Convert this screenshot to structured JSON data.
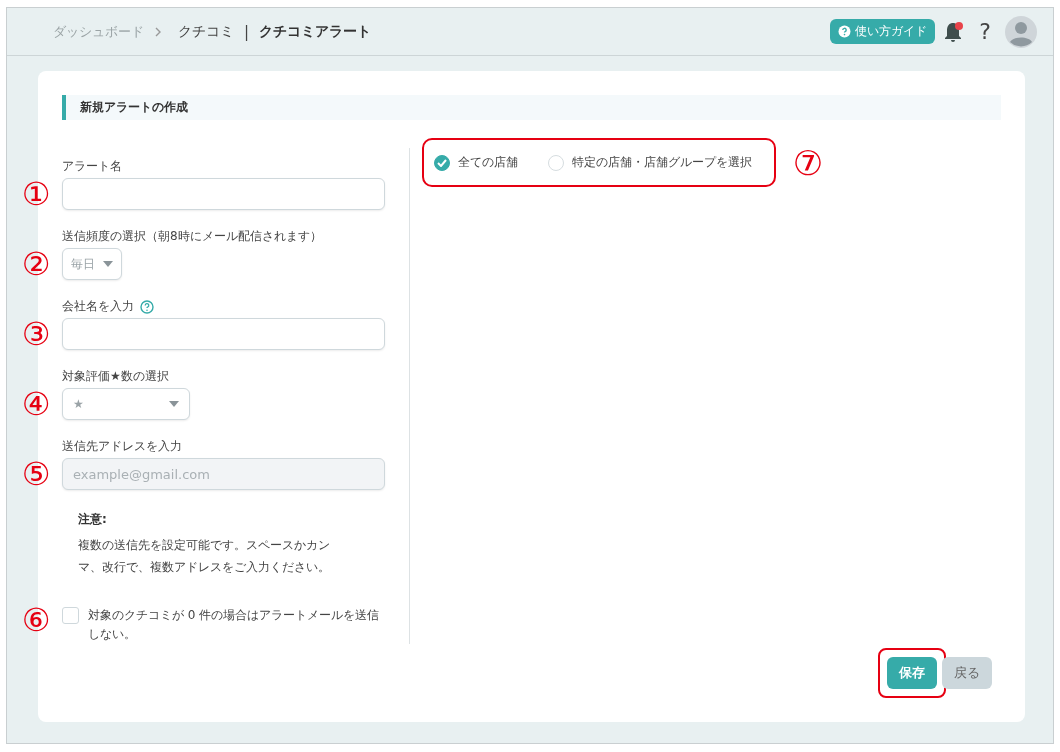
{
  "header": {
    "breadcrumbs": [
      {
        "label": "ダッシュボード"
      },
      {
        "label": "クチコミ"
      }
    ],
    "separator": "|",
    "page_title": "クチコミアラート",
    "guide_button": "使い方ガイド",
    "help": "?",
    "notifications": {
      "unread": true
    }
  },
  "section_title": "新規アラートの作成",
  "fields": [
    {
      "kind": "text",
      "label": "アラート名",
      "annotation": "①"
    },
    {
      "kind": "select",
      "label": "送信頻度の選択（朝8時にメール配信されます）",
      "value": "毎日",
      "annotation": "②"
    },
    {
      "kind": "text",
      "label": "会社名を入力",
      "help": true,
      "annotation": "③"
    },
    {
      "kind": "wide-select",
      "label": "対象評価★数の選択",
      "value": "★",
      "annotation": "④"
    },
    {
      "kind": "text",
      "label": "送信先アドレスを入力",
      "placeholder": "example@gmail.com",
      "disabled": true,
      "annotation": "⑤"
    }
  ],
  "note": {
    "title": "注意:",
    "text": "複数の送信先を設定可能です。スペースかカンマ、改行で、複数アドレスをご入力ください。"
  },
  "checkbox": {
    "label": "対象のクチコミが 0 件の場合はアラートメールを送信しない。",
    "checked": false,
    "annotation": "⑥"
  },
  "store_scope": {
    "highlighted": true,
    "annotation": "⑦",
    "options": [
      {
        "label": "全ての店舗",
        "selected": true
      },
      {
        "label": "特定の店舗・店舗グループを選択",
        "selected": false
      }
    ]
  },
  "buttons": [
    {
      "label": "保存",
      "kind": "primary",
      "highlighted": true
    },
    {
      "label": "戻る",
      "kind": "secondary",
      "highlighted": false
    }
  ]
}
